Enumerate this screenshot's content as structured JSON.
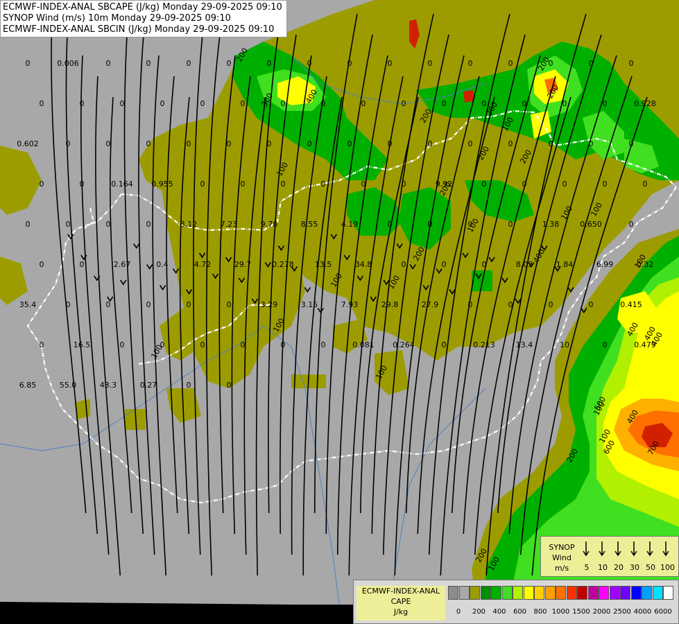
{
  "header": {
    "line1": "ECMWF-INDEX-ANAL SBCAPE (J/kg) Monday 29-09-2025 09:10",
    "line2": "SYNOP Wind (m/s) 10m Monday 29-09-2025 09:10",
    "line3": "ECMWF-INDEX-ANAL SBCIN (J/kg) Monday 29-09-2025 09:10"
  },
  "colors": {
    "background": "#a8a8a8",
    "olive": "#9c9c00",
    "green": "#00b000",
    "light_green": "#40e020",
    "yellow_green": "#b0f000",
    "yellow": "#ffff00",
    "orange": "#ff9000",
    "red": "#d02000",
    "border_white": "#ffffff",
    "streamline": "#000000"
  },
  "cape_labels": [
    "200",
    "300",
    "400",
    "200",
    "200",
    "200",
    "200",
    "100",
    "200",
    "200",
    "100",
    "100",
    "100",
    "100",
    "100",
    "200",
    "100",
    "100",
    "400",
    "400",
    "100",
    "100",
    "400",
    "700",
    "600",
    "500",
    "400",
    "200",
    "100",
    "200",
    "100",
    "100",
    "400",
    "100",
    "200"
  ],
  "cin_values": [
    "0",
    "0.006",
    "0",
    "0",
    "0",
    "0",
    "0",
    "0",
    "0",
    "0",
    "0",
    "0",
    "0",
    "0",
    "0",
    "0",
    "0",
    "0",
    "0",
    "0",
    "0",
    "0",
    "0",
    "0",
    "0",
    "0",
    "0",
    "0",
    "0",
    "0",
    "0",
    "0.928",
    "0.602",
    "0",
    "0",
    "0",
    "0",
    "0",
    "0",
    "0",
    "0",
    "0",
    "0",
    "0",
    "0",
    "0",
    "0",
    "0",
    "0",
    "0",
    "0.164",
    "0.955",
    "0",
    "0",
    "0",
    "0",
    "0",
    "0",
    "9.92",
    "0",
    "0",
    "0",
    "0",
    "0",
    "0",
    "0",
    "0",
    "0",
    "3.12",
    "7.23",
    "9.70",
    "8.55",
    "4.19",
    "0",
    "0",
    "0",
    "0",
    "1.38",
    "0.650",
    "0",
    "0",
    "0",
    "2.67",
    "0.4",
    "4.72",
    "29.7",
    "0.278",
    "13.5",
    "34.8",
    "0",
    "0",
    "0",
    "8.03",
    "1.84",
    "6.99",
    "0.32",
    "35.4",
    "0",
    "0",
    "0",
    "0",
    "0",
    "3.29",
    "3.15",
    "7.93",
    "29.8",
    "27.9",
    "0",
    "0",
    "0",
    "0",
    "0.415",
    "0",
    "16.5",
    "0",
    "0",
    "0",
    "0",
    "0",
    "0",
    "0.081",
    "0.264",
    "0",
    "0.213",
    "13.4",
    "10",
    "0",
    "0.479",
    "6.85",
    "55.0",
    "43.3",
    "0.27",
    "0",
    "0"
  ],
  "synop_legend": {
    "title": "SYNOP",
    "subtitle": "Wind",
    "unit": "m/s",
    "values": [
      "5",
      "10",
      "20",
      "30",
      "50",
      "100"
    ]
  },
  "cape_legend": {
    "title": "ECMWF-INDEX-ANAL",
    "subtitle": "CAPE",
    "unit": "J/kg",
    "ticks": [
      "0",
      "200",
      "400",
      "600",
      "800",
      "1000",
      "1500",
      "2000",
      "2500",
      "4000",
      "6000"
    ],
    "swatches": [
      "#8c8c8c",
      "#a8a8a8",
      "#9c9c00",
      "#009000",
      "#00b000",
      "#40e020",
      "#b0f000",
      "#ffff00",
      "#ffd000",
      "#ffa000",
      "#ff7000",
      "#ff3000",
      "#c00000",
      "#c000a0",
      "#ff00ff",
      "#a000ff",
      "#7000ff",
      "#0000ff",
      "#00a0ff",
      "#00e0ff",
      "#ffffff"
    ]
  }
}
